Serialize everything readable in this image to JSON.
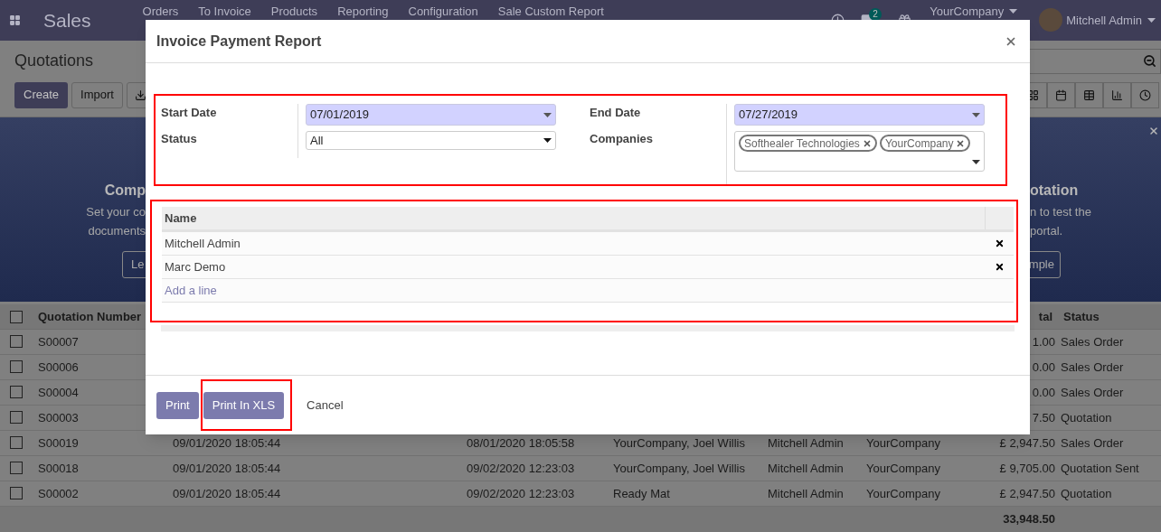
{
  "navbar": {
    "app": "Sales",
    "menu": [
      "Orders",
      "To Invoice",
      "Products",
      "Reporting",
      "Configuration",
      "Sale Custom Report"
    ],
    "chat_count": "2",
    "company": "YourCompany",
    "user": "Mitchell Admin"
  },
  "control_panel": {
    "title": "Quotations",
    "buttons": [
      "Create",
      "Import"
    ]
  },
  "banner": {
    "left": {
      "heading": "Comp",
      "lines": [
        "Set your co",
        "documents"
      ],
      "button": "Le"
    },
    "right": {
      "heading": "otation",
      "lines": [
        "n to test the",
        "portal."
      ],
      "button": "mple"
    }
  },
  "list": {
    "columns": [
      "Quotation Number",
      "tal",
      "Status"
    ],
    "header_checked": false,
    "rows": [
      {
        "checked": false,
        "number": "S00007",
        "total": "1.00",
        "status": "Sales Order"
      },
      {
        "checked": false,
        "number": "S00006",
        "total": "0.00",
        "status": "Sales Order"
      },
      {
        "checked": false,
        "number": "S00004",
        "total": "0.00",
        "status": "Sales Order"
      },
      {
        "checked": false,
        "number": "S00003",
        "total": "7.50",
        "status": "Quotation"
      },
      {
        "checked": false,
        "number": "S00019",
        "created": "09/01/2020 18:05:44",
        "expected": "08/01/2020 18:05:58",
        "customer": "YourCompany, Joel Willis",
        "salesperson": "Mitchell Admin",
        "company": "YourCompany",
        "total": "£ 2,947.50",
        "status": "Sales Order"
      },
      {
        "checked": false,
        "number": "S00018",
        "created": "09/01/2020 18:05:44",
        "expected": "09/02/2020 12:23:03",
        "customer": "YourCompany, Joel Willis",
        "salesperson": "Mitchell Admin",
        "company": "YourCompany",
        "total": "£ 9,705.00",
        "status": "Quotation Sent"
      },
      {
        "checked": false,
        "number": "S00002",
        "created": "09/01/2020 18:05:44",
        "expected": "09/02/2020 12:23:03",
        "customer": "Ready Mat",
        "salesperson": "Mitchell Admin",
        "company": "YourCompany",
        "total": "£ 2,947.50",
        "status": "Quotation"
      }
    ],
    "sum": "33,948.50"
  },
  "dialog": {
    "title": "Invoice Payment Report",
    "filters": {
      "highlighted": true,
      "left": [
        {
          "label": "Start Date",
          "kind": "date",
          "value": "07/01/2019"
        },
        {
          "label": "Status",
          "kind": "select",
          "value": "All"
        }
      ],
      "right": [
        {
          "label": "End Date",
          "kind": "date",
          "value": "07/27/2019"
        },
        {
          "label": "Companies",
          "kind": "tags",
          "tags": [
            "Softhealer Technologies",
            "YourCompany"
          ]
        }
      ]
    },
    "lines": {
      "highlighted": true,
      "column": "Name",
      "rows": [
        "Mitchell Admin",
        "Marc Demo"
      ],
      "add": "Add a line"
    },
    "footer": [
      {
        "label": "Print",
        "kind": "button",
        "highlighted": false
      },
      {
        "label": "Print In XLS",
        "kind": "button",
        "highlighted": true
      },
      {
        "label": "Cancel",
        "kind": "link",
        "highlighted": false
      }
    ]
  }
}
